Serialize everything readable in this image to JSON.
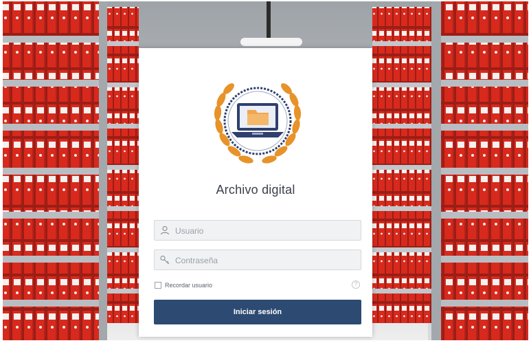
{
  "app": {
    "title": "Archivo digital"
  },
  "login": {
    "username_placeholder": "Usuario",
    "password_placeholder": "Contraseña",
    "remember_label": "Recordar usuario",
    "help_glyph": "?",
    "submit_label": "Iniciar sesión"
  },
  "icons": {
    "logo": "laurel-laptop-folder-logo",
    "username": "user-icon",
    "password": "key-icon",
    "help": "question-circle-icon"
  },
  "colors": {
    "primary_button": "#2c4a72",
    "binder_red": "#d6281c",
    "laurel_orange": "#e8922a",
    "logo_navy": "#2f3f6e",
    "folder_orange": "#f0a650"
  }
}
